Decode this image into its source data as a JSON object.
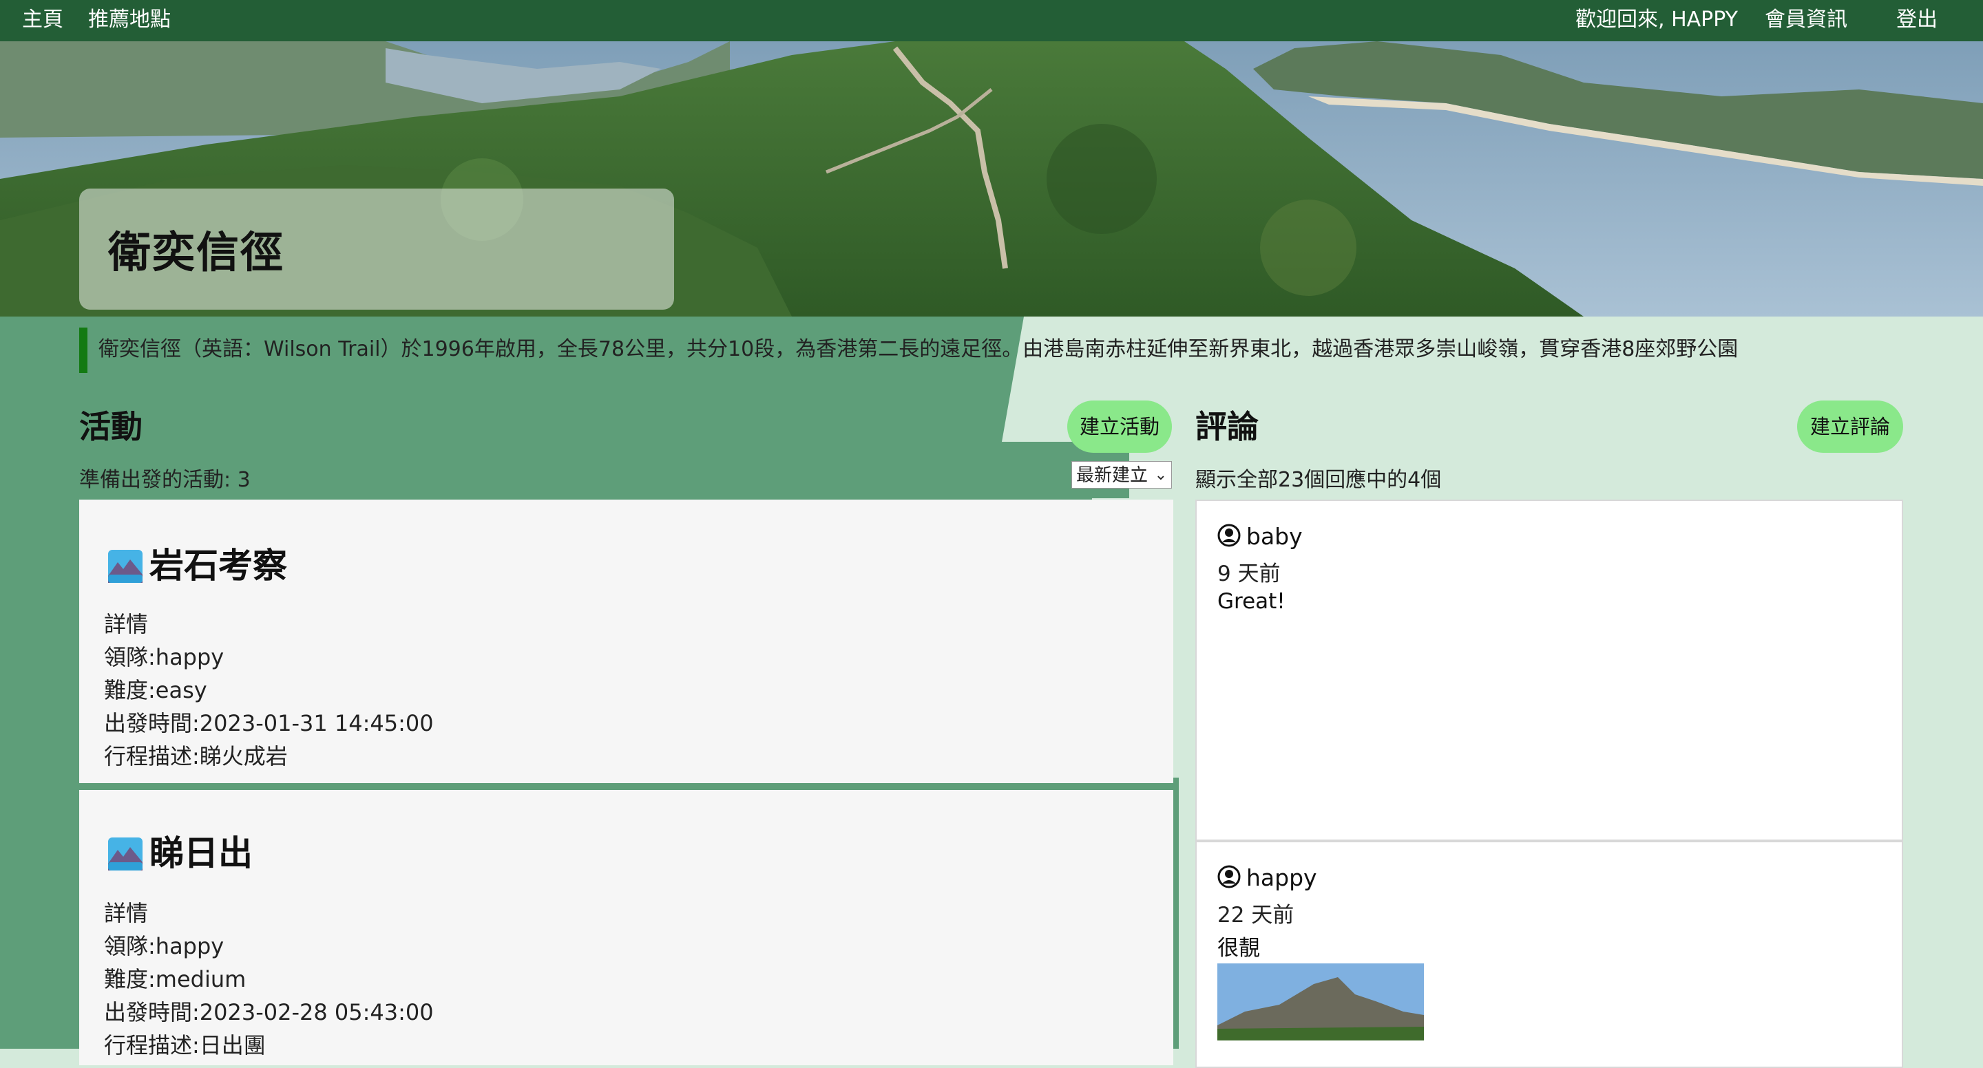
{
  "nav": {
    "home": "主頁",
    "recommended": "推薦地點",
    "welcome": "歡迎回來, HAPPY",
    "member_info": "會員資訊",
    "logout": "登出"
  },
  "trail": {
    "name": "衛奕信徑",
    "description": "衛奕信徑（英語：Wilson Trail）於1996年啟用，全長78公里，共分10段，為香港第二長的遠足徑。由港島南赤柱延伸至新界東北，越過香港眾多崇山峻嶺，貫穿香港8座郊野公園"
  },
  "activities": {
    "title": "活動",
    "create_button": "建立活動",
    "count_text": "準備出發的活動: 3",
    "sort": {
      "selected": "最新建立"
    },
    "items": [
      {
        "title": "岩石考察",
        "details": "詳情",
        "leader": "領隊:happy",
        "difficulty": "難度:easy",
        "departure": "出發時間:2023-01-31 14:45:00",
        "itinerary": "行程描述:睇火成岩"
      },
      {
        "title": "睇日出",
        "details": "詳情",
        "leader": "領隊:happy",
        "difficulty": "難度:medium",
        "departure": "出發時間:2023-02-28 05:43:00",
        "itinerary": "行程描述:日出團"
      }
    ]
  },
  "reviews": {
    "title": "評論",
    "create_button": "建立評論",
    "count_text": "顯示全部23個回應中的4個",
    "items": [
      {
        "user": "baby",
        "time": "9 天前",
        "text": "Great!"
      },
      {
        "user": "happy",
        "time": "22 天前",
        "text": "很靚"
      }
    ]
  },
  "colors": {
    "navbar": "#235e36",
    "panel_green": "#5e9e79",
    "light_green": "#d4eadb",
    "button_green": "#8ae88a",
    "accent_bar": "#137a13"
  }
}
